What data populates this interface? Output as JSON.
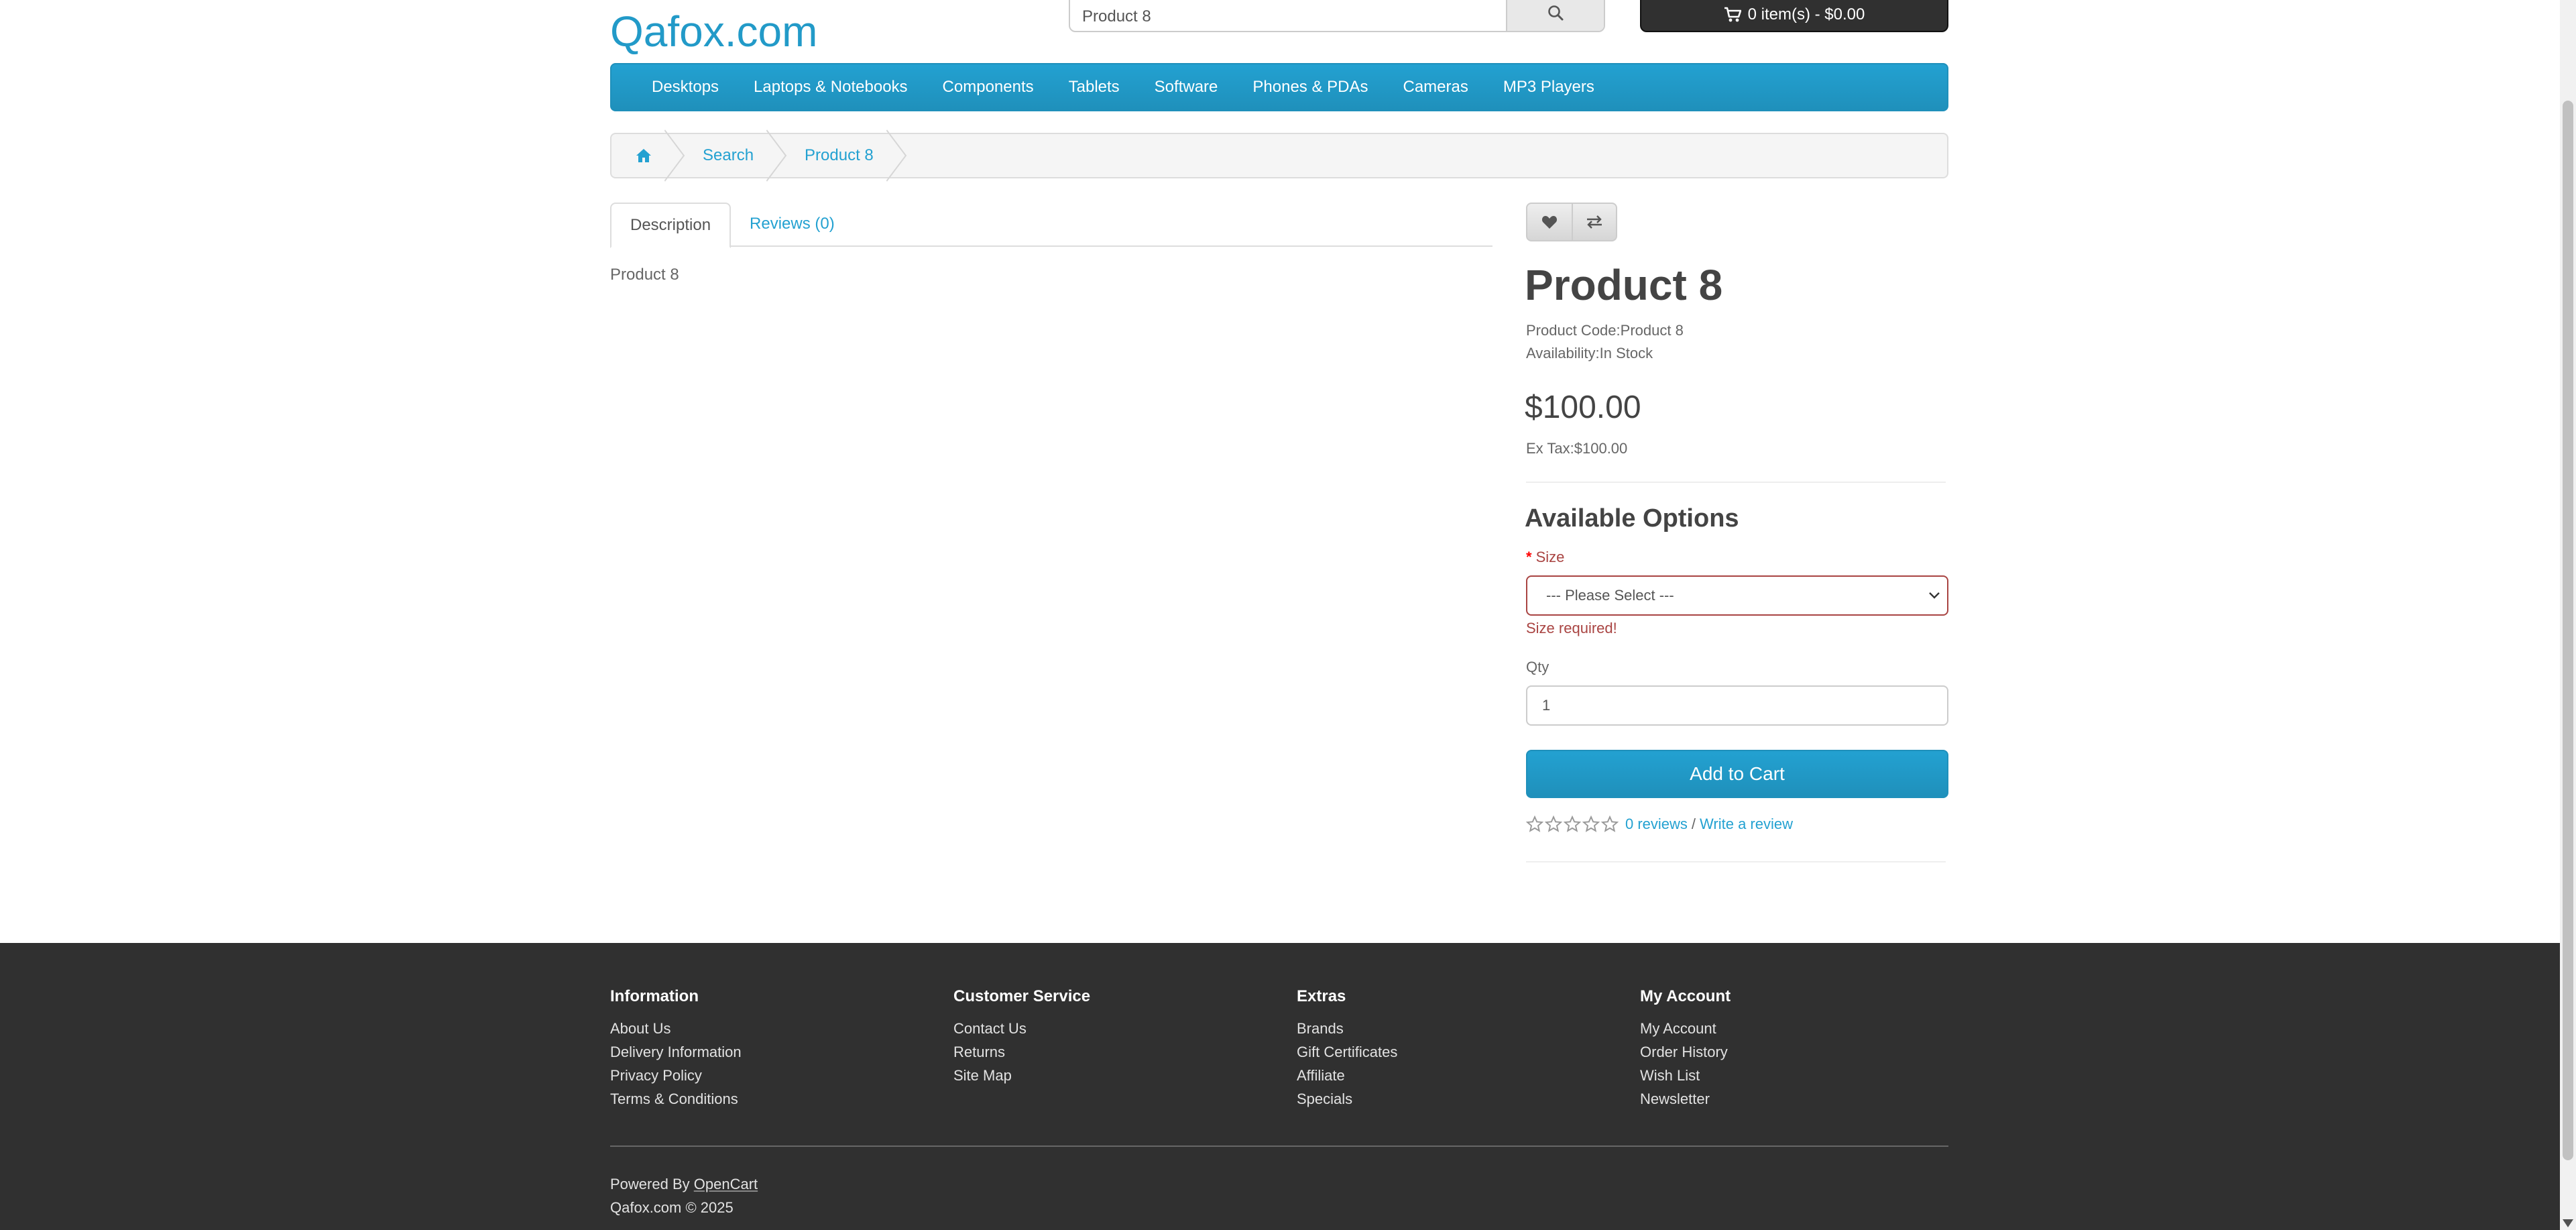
{
  "header": {
    "logo": "Qafox.com",
    "search_value": "Product 8",
    "cart_label": "0 item(s) - $0.00"
  },
  "menu": [
    "Desktops",
    "Laptops & Notebooks",
    "Components",
    "Tablets",
    "Software",
    "Phones & PDAs",
    "Cameras",
    "MP3 Players"
  ],
  "breadcrumb": [
    "Search",
    "Product 8"
  ],
  "tabs": {
    "description": "Description",
    "reviews": "Reviews (0)"
  },
  "description_text": "Product 8",
  "product": {
    "title": "Product 8",
    "code_label": "Product Code:",
    "code_value": "Product 8",
    "availability_label": "Availability:",
    "availability_value": "In Stock",
    "price": "$100.00",
    "ex_tax_label": "Ex Tax:",
    "ex_tax_value": "$100.00"
  },
  "options": {
    "title": "Available Options",
    "size_required_mark": "*",
    "size_label": "Size",
    "size_selected": "--- Please Select ---",
    "size_error": "Size required!",
    "qty_label": "Qty",
    "qty_value": "1",
    "add_to_cart": "Add to Cart"
  },
  "rating": {
    "stars_filled": 0,
    "stars_total": 5,
    "reviews_link": "0 reviews",
    "separator": "/",
    "write_link": "Write a review"
  },
  "footer": {
    "columns": [
      {
        "title": "Information",
        "links": [
          "About Us",
          "Delivery Information",
          "Privacy Policy",
          "Terms & Conditions"
        ]
      },
      {
        "title": "Customer Service",
        "links": [
          "Contact Us",
          "Returns",
          "Site Map"
        ]
      },
      {
        "title": "Extras",
        "links": [
          "Brands",
          "Gift Certificates",
          "Affiliate",
          "Specials"
        ]
      },
      {
        "title": "My Account",
        "links": [
          "My Account",
          "Order History",
          "Wish List",
          "Newsletter"
        ]
      }
    ],
    "powered_by": "Powered By",
    "powered_link": "OpenCart",
    "copyright": "Qafox.com © 2025"
  },
  "colors": {
    "accent": "#229ac8",
    "footer_bg": "#303030",
    "error": "#a94442"
  },
  "icons": {
    "search": "search-icon",
    "cart": "shopping-cart-icon",
    "home": "home-icon",
    "wishlist": "heart-icon",
    "compare": "exchange-icon",
    "star": "star-outline-icon",
    "select": "chevron-down-icon"
  }
}
